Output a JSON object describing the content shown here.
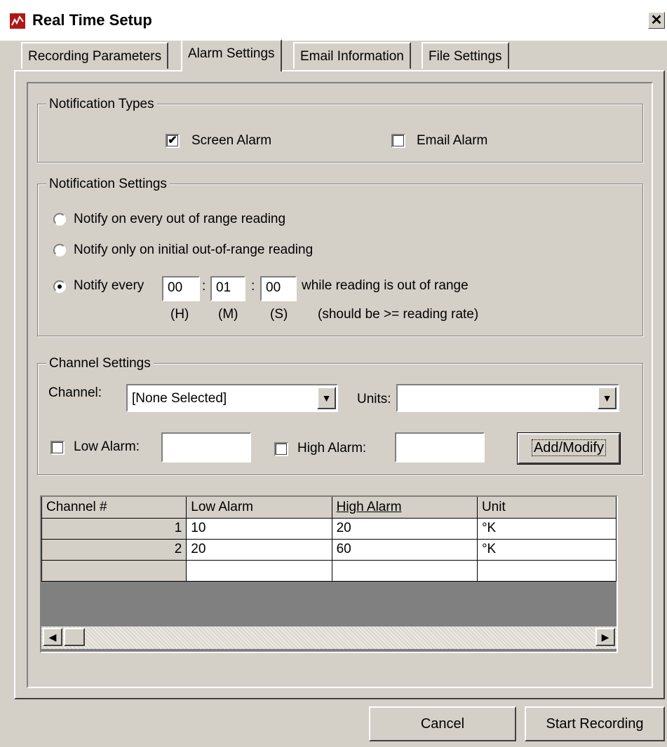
{
  "window": {
    "title": "Real Time Setup",
    "close_glyph": "✕"
  },
  "tabs": [
    {
      "label": "Recording Parameters"
    },
    {
      "label": "Alarm Settings"
    },
    {
      "label": "Email Information"
    },
    {
      "label": "File Settings"
    }
  ],
  "notification_types": {
    "label": "Notification Types",
    "screen_alarm": {
      "label": "Screen Alarm",
      "checked": true
    },
    "email_alarm": {
      "label": "Email Alarm",
      "checked": false
    }
  },
  "notification_settings": {
    "label": "Notification Settings",
    "options": [
      {
        "label": "Notify on every out of range reading",
        "selected": false
      },
      {
        "label": "Notify only on initial out-of-range reading",
        "selected": false
      },
      {
        "label": "Notify every",
        "selected": true
      }
    ],
    "hours": "00",
    "minutes": "01",
    "seconds": "00",
    "colon": ":",
    "suffix": "while reading is out of range",
    "h_label": "(H)",
    "m_label": "(M)",
    "s_label": "(S)",
    "hint": "(should be >= reading rate)"
  },
  "channel_settings": {
    "label": "Channel Settings",
    "channel_label": "Channel:",
    "channel_value": "[None Selected]",
    "units_label": "Units:",
    "units_value": "",
    "low_alarm_label": "Low Alarm:",
    "low_alarm_value": "",
    "high_alarm_label": "High Alarm:",
    "high_alarm_value": "",
    "add_modify_label": "Add/Modify"
  },
  "grid": {
    "columns": [
      "Channel #",
      "Low Alarm",
      "High Alarm",
      "Unit"
    ],
    "rows": [
      {
        "channel": "1",
        "low": "10",
        "high": "20",
        "unit": "°K"
      },
      {
        "channel": "2",
        "low": "20",
        "high": "60",
        "unit": "°K"
      }
    ]
  },
  "footer": {
    "cancel_label": "Cancel",
    "start_label": "Start Recording"
  },
  "colors": {
    "face": "#d4d0c8",
    "shadow": "#808080",
    "grid_empty": "#808080"
  }
}
